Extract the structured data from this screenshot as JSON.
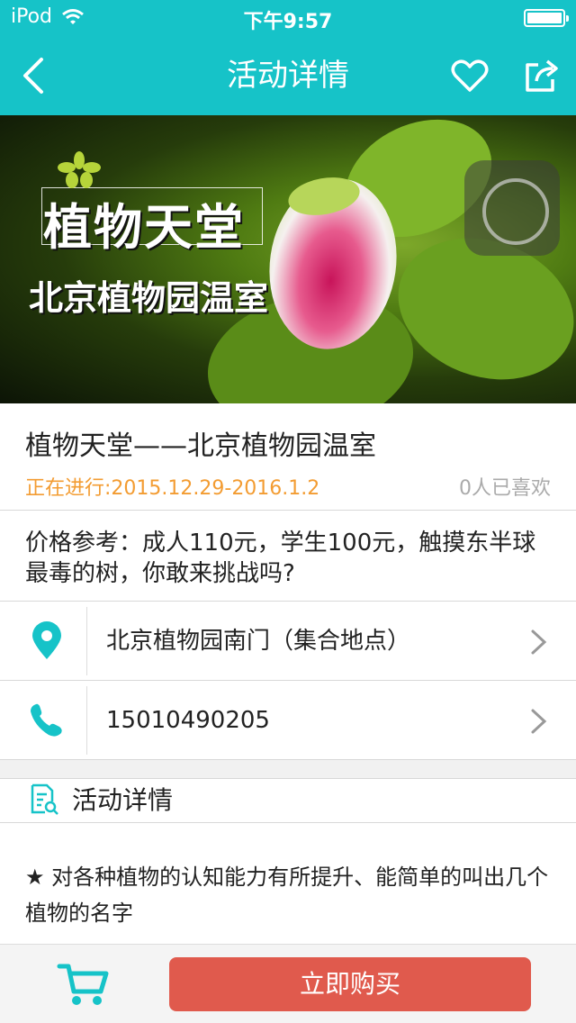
{
  "status_bar": {
    "device": "iPod",
    "time": "下午9:57"
  },
  "nav": {
    "title": "活动详情"
  },
  "banner": {
    "title": "植物天堂",
    "subtitle": "北京植物园温室"
  },
  "event": {
    "title": "植物天堂——北京植物园温室",
    "date": "正在进行:2015.12.29-2016.1.2",
    "likes": "0人已喜欢",
    "price": "价格参考：成人110元，学生100元，触摸东半球最毒的树，你敢来挑战吗?"
  },
  "location": {
    "text": "北京植物园南门（集合地点）",
    "icon": "location-pin-icon"
  },
  "phone": {
    "text": "15010490205",
    "icon": "phone-icon"
  },
  "details": {
    "heading": "活动详情",
    "body": "★ 对各种植物的认知能力有所提升、能简单的叫出几个植物的名字"
  },
  "bottom": {
    "buy_label": "立即购买"
  },
  "colors": {
    "accent": "#16c3c8",
    "orange": "#f39c32",
    "buy": "#e05a4d"
  }
}
